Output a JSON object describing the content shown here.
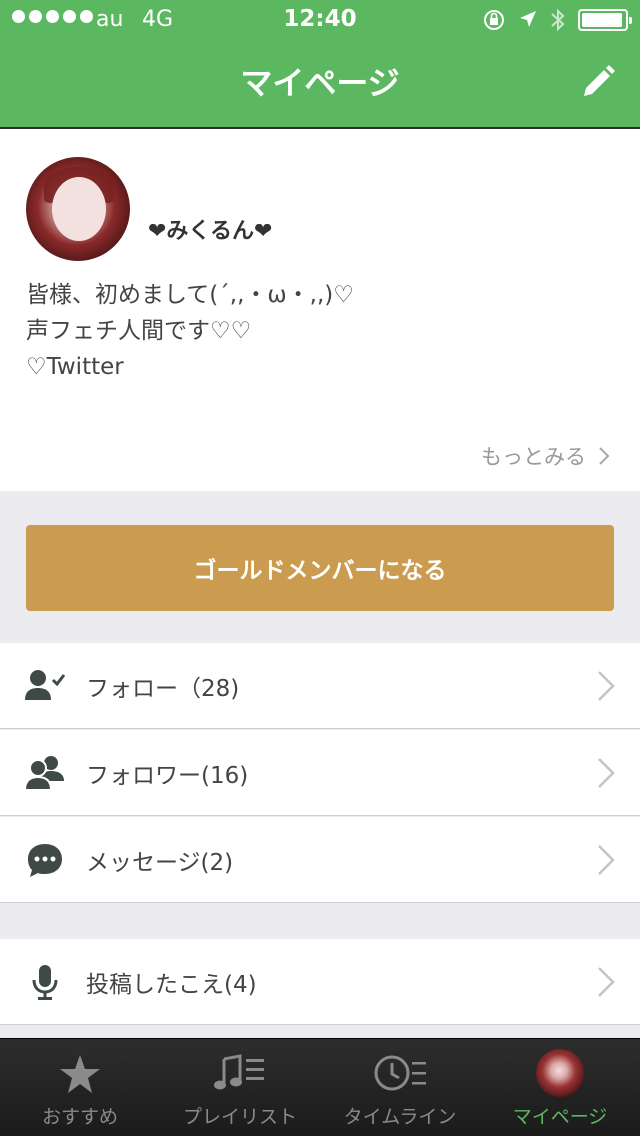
{
  "status_bar": {
    "carrier": "au",
    "network": "4G",
    "time": "12:40",
    "battery_level": 0.95
  },
  "nav": {
    "title": "マイページ",
    "edit_icon": "pencil-icon"
  },
  "profile": {
    "username": "❤みくるん❤",
    "bio_lines": [
      "皆様、初めまして(´,,・ω・,,)♡",
      "声フェチ人間です♡♡",
      "♡Twitter"
    ],
    "more_label": "もっとみる"
  },
  "gold_button": {
    "label": "ゴールドメンバーになる",
    "color": "#cb9c4f"
  },
  "menu": {
    "follow": {
      "label": "フォロー（28)",
      "icon": "user-check-icon"
    },
    "followers": {
      "label": "フォロワー(16)",
      "icon": "users-icon"
    },
    "messages": {
      "label": "メッセージ(2)",
      "icon": "chat-bubble-icon"
    },
    "posts": {
      "label": "投稿したこえ(4)",
      "icon": "microphone-icon"
    }
  },
  "tabbar": {
    "tabs": [
      {
        "label": "おすすめ",
        "icon": "star-icon"
      },
      {
        "label": "プレイリスト",
        "icon": "music-list-icon"
      },
      {
        "label": "タイムライン",
        "icon": "clock-list-icon"
      },
      {
        "label": "マイページ",
        "icon": "avatar"
      }
    ],
    "active_index": 3
  },
  "colors": {
    "header_green": "#5cb860",
    "active_tab": "#5cb860",
    "gold": "#cb9c4f"
  }
}
